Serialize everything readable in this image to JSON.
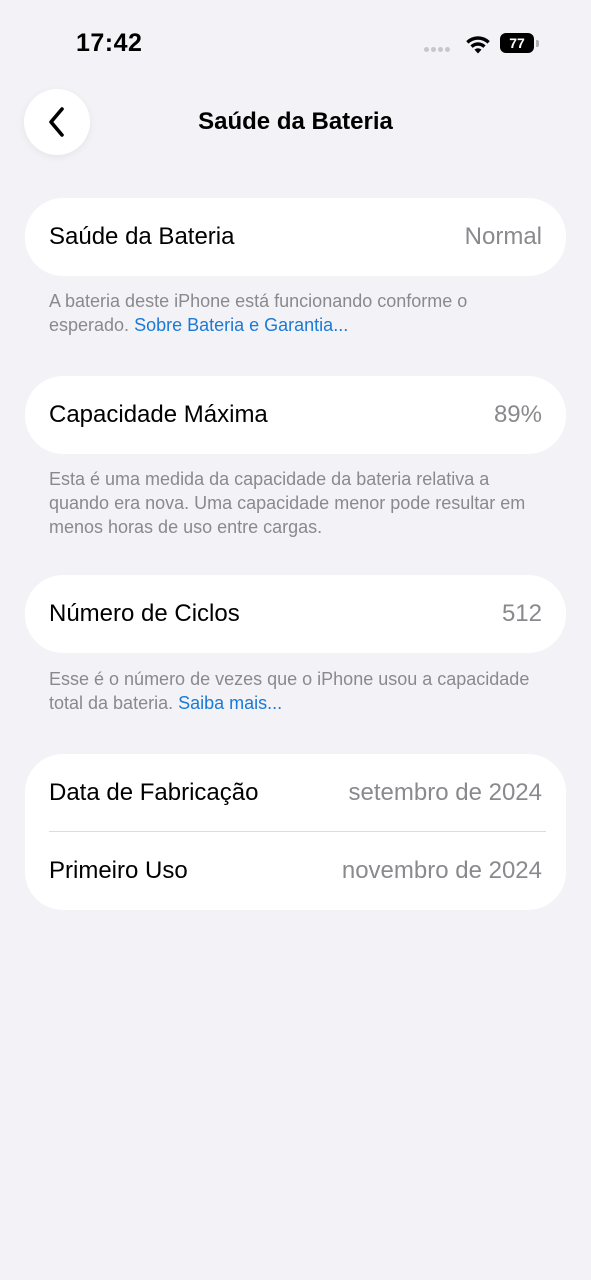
{
  "status_bar": {
    "time": "17:42",
    "battery_level": "77",
    "wifi_icon": "wifi-icon",
    "battery_icon": "battery-icon"
  },
  "nav": {
    "back_icon": "chevron-left-icon",
    "title": "Saúde da Bateria"
  },
  "health": {
    "label": "Saúde da Bateria",
    "value": "Normal",
    "note": "A bateria deste iPhone está funcionando conforme o esperado.",
    "note_link": "Sobre Bateria e Garantia..."
  },
  "capacity": {
    "label": "Capacidade Máxima",
    "value": "89%",
    "note": "Esta é uma medida da capacidade da bateria relativa a quando era nova. Uma capacidade menor pode resultar em menos horas de uso entre cargas."
  },
  "cycles": {
    "label": "Número de Ciclos",
    "value": "512",
    "note": "Esse é o número de vezes que o iPhone usou a capacidade total da bateria.",
    "note_link": "Saiba mais..."
  },
  "dates": {
    "manufacture_label": "Data de Fabricação",
    "manufacture_value": "setembro de 2024",
    "first_use_label": "Primeiro Uso",
    "first_use_value": "novembro de 2024"
  },
  "colors": {
    "background": "#f2f2f7",
    "card": "#ffffff",
    "secondary_text": "#8a8a8e",
    "link": "#1a7ad6"
  }
}
